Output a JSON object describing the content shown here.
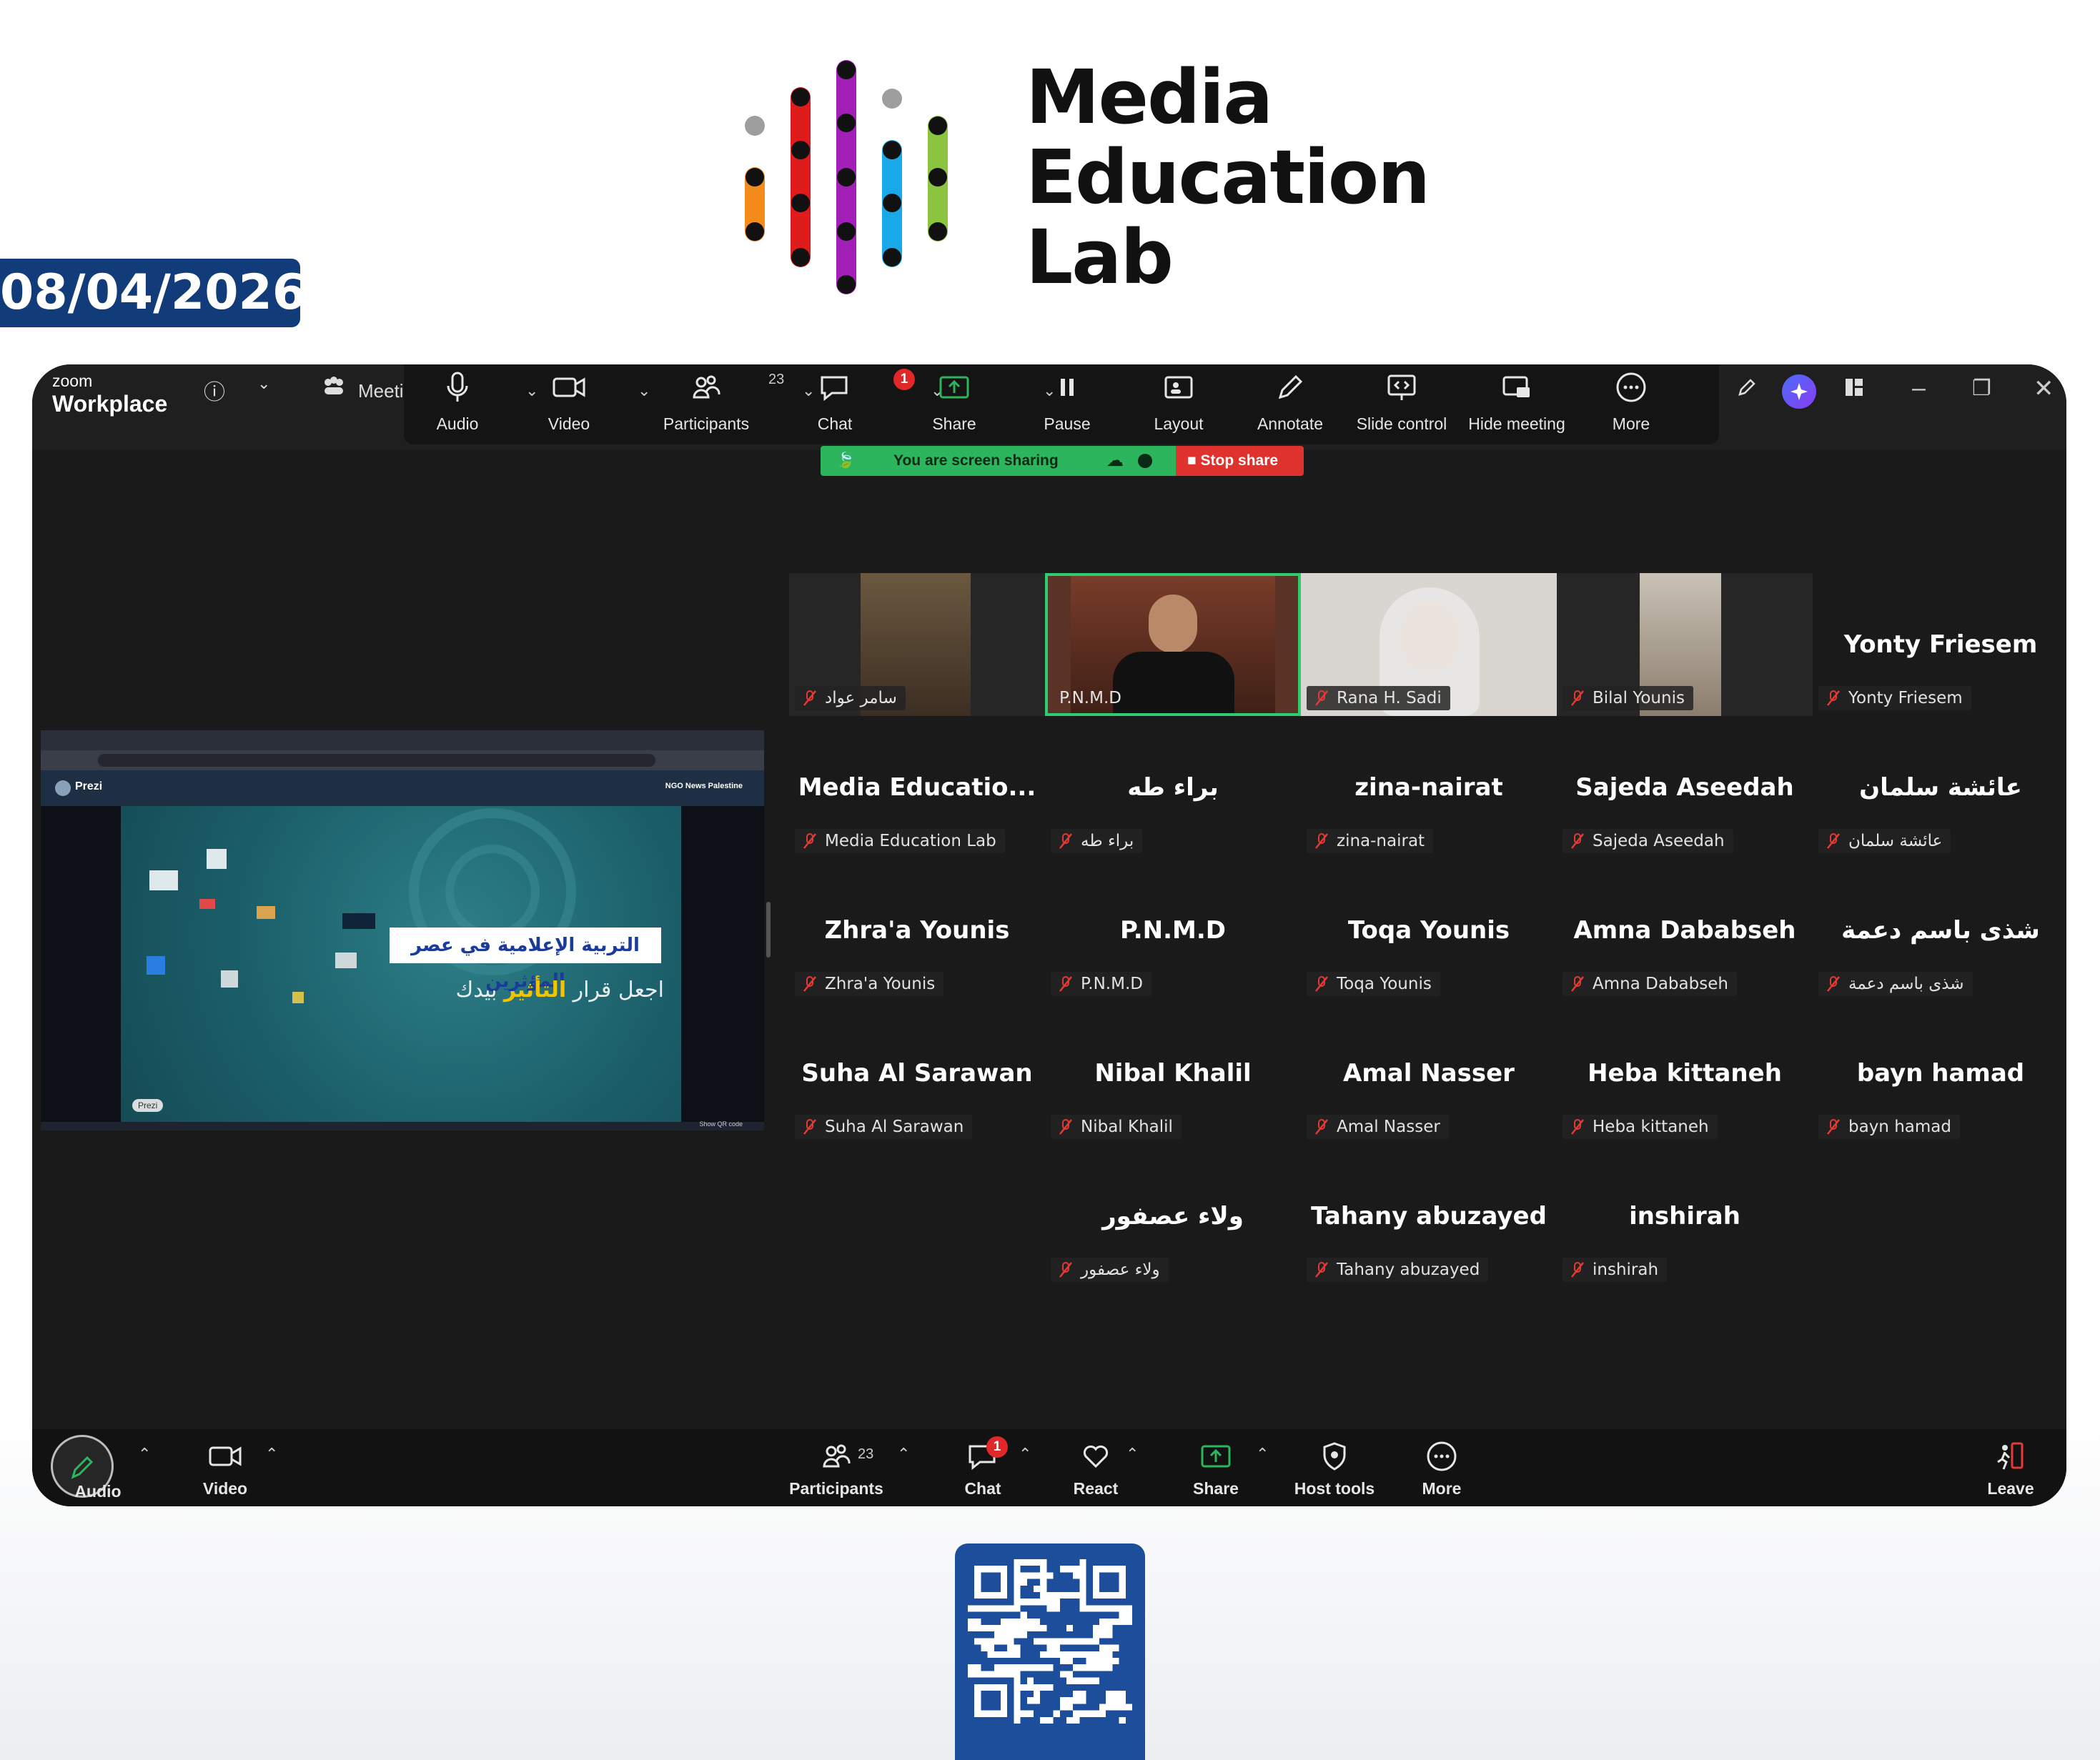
{
  "brand": {
    "logo_line1": "Media",
    "logo_line2": "Education",
    "logo_line3": "Lab",
    "colors": [
      "#9e9e9e",
      "#f28a1c",
      "#e01b1b",
      "#a21fb8",
      "#19a9e8",
      "#8bc53f"
    ]
  },
  "date": "08/04/2026",
  "window": {
    "app_small": "zoom",
    "app_name": "Workplace",
    "meeting_tab": "Meeti"
  },
  "top_toolbar": {
    "audio": "Audio",
    "video": "Video",
    "participants": "Participants",
    "participants_count": "23",
    "chat": "Chat",
    "chat_badge": "1",
    "share": "Share",
    "pause": "Pause",
    "layout": "Layout",
    "annotate": "Annotate",
    "slide_control": "Slide control",
    "hide_meeting": "Hide meeting",
    "more": "More"
  },
  "share_status": {
    "message": "You are screen sharing",
    "stop_label": "Stop share"
  },
  "shared_screen": {
    "app_label": "Prezi",
    "channel": "NGO News Palestine",
    "slide_title": "التربية الإعلامية في عصر المؤثرين",
    "slide_sub_before": "اجعل قرار ",
    "slide_sub_highlight": "التأثير",
    "slide_sub_after": " بيدك",
    "watermark": "Prezi",
    "footer": "Show QR code"
  },
  "participants": [
    {
      "big": "",
      "tag": "سامر عواد",
      "video": true
    },
    {
      "big": "",
      "tag": "P.N.M.D",
      "video": true,
      "active": true
    },
    {
      "big": "",
      "tag": "Rana H. Sadi",
      "video": true
    },
    {
      "big": "",
      "tag": "Bilal Younis",
      "video": true
    },
    {
      "big": "Yonty Friesem",
      "tag": "Yonty Friesem"
    },
    {
      "big": "Media  Educatio...",
      "tag": "Media Education Lab"
    },
    {
      "big": "براء طه",
      "tag": "براء طه"
    },
    {
      "big": "zina-nairat",
      "tag": "zina-nairat"
    },
    {
      "big": "Sajeda Aseedah",
      "tag": "Sajeda Aseedah"
    },
    {
      "big": "عائشة سلمان",
      "tag": "عائشة سلمان"
    },
    {
      "big": "Zhra'a Younis",
      "tag": "Zhra'a Younis"
    },
    {
      "big": "P.N.M.D",
      "tag": "P.N.M.D"
    },
    {
      "big": "Toqa Younis",
      "tag": "Toqa Younis"
    },
    {
      "big": "Amna Dababseh",
      "tag": "Amna Dababseh"
    },
    {
      "big": "شذى باسم دعمة",
      "tag": "شذى باسم دعمة"
    },
    {
      "big": "Suha Al Sarawan",
      "tag": "Suha Al Sarawan"
    },
    {
      "big": "Nibal Khalil",
      "tag": "Nibal Khalil"
    },
    {
      "big": "Amal Nasser",
      "tag": "Amal Nasser"
    },
    {
      "big": "Heba kittaneh",
      "tag": "Heba kittaneh"
    },
    {
      "big": "bayn hamad",
      "tag": "bayn hamad"
    },
    {
      "big": "ولاء عصفور",
      "tag": "ولاء عصفور"
    },
    {
      "big": "Tahany abuzayed",
      "tag": "Tahany abuzayed"
    },
    {
      "big": "inshirah",
      "tag": "inshirah"
    }
  ],
  "bottom_toolbar": {
    "audio": "Audio",
    "video": "Video",
    "participants": "Participants",
    "participants_count": "23",
    "chat": "Chat",
    "chat_badge": "1",
    "react": "React",
    "share": "Share",
    "host_tools": "Host tools",
    "more": "More",
    "leave": "Leave"
  },
  "colors": {
    "share_green": "#2db55d",
    "stop_red": "#e0322c",
    "active_speaker": "#2ecc71",
    "date_bg": "#123b7a",
    "qr_bg": "#1d4e9c"
  }
}
